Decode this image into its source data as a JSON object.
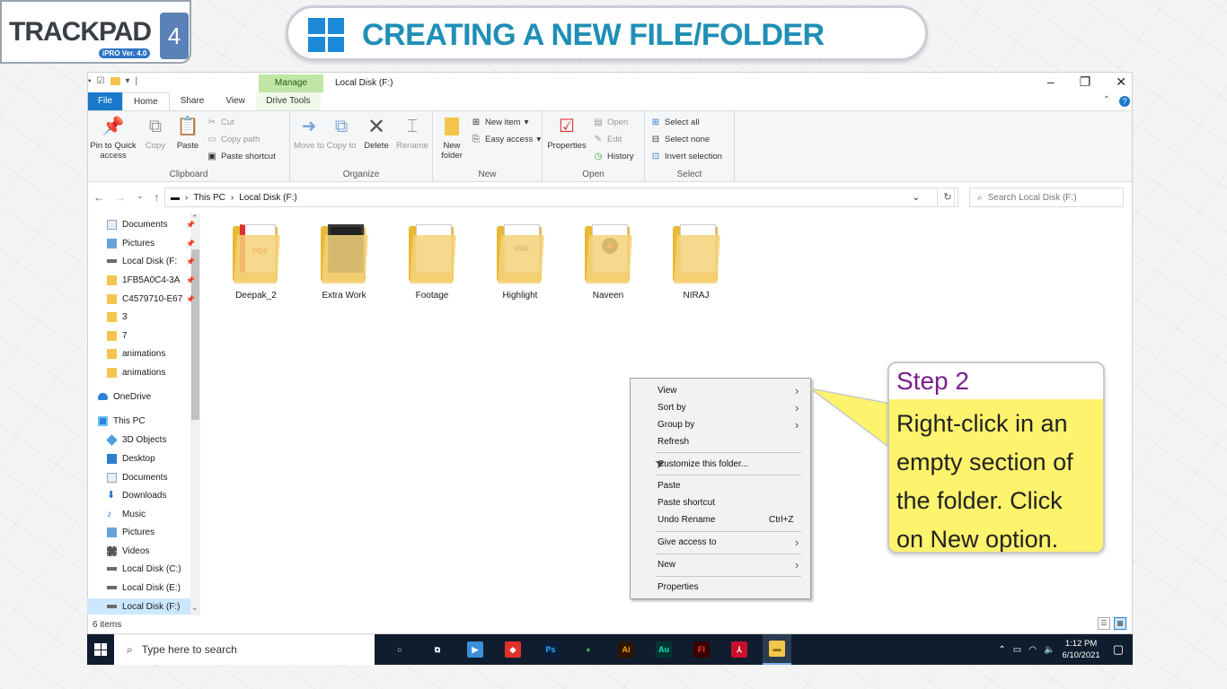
{
  "branding": {
    "logo_text": "TRACKPAD",
    "logo_sub": "iPRO Ver. 4.0",
    "logo_num": "4",
    "title": "CREATING A NEW FILE/FOLDER"
  },
  "window": {
    "manage_tab": "Manage",
    "title": "Local Disk (F:)",
    "tabs": [
      "File",
      "Home",
      "Share",
      "View",
      "Drive Tools"
    ]
  },
  "ribbon": {
    "clipboard": {
      "label": "Clipboard",
      "pin": "Pin to Quick access",
      "copy": "Copy",
      "paste": "Paste",
      "cut": "Cut",
      "copy_path": "Copy path",
      "paste_shortcut": "Paste shortcut"
    },
    "organize": {
      "label": "Organize",
      "move_to": "Move to",
      "copy_to": "Copy to",
      "delete": "Delete",
      "rename": "Rename"
    },
    "new": {
      "label": "New",
      "new_folder": "New folder",
      "new_item": "New item",
      "easy_access": "Easy access"
    },
    "open": {
      "label": "Open",
      "properties": "Properties",
      "open": "Open",
      "edit": "Edit",
      "history": "History"
    },
    "select": {
      "label": "Select",
      "select_all": "Select all",
      "select_none": "Select none",
      "invert": "Invert selection"
    }
  },
  "address": {
    "path": [
      "This PC",
      "Local Disk (F:)"
    ],
    "search_placeholder": "Search Local Disk (F:)"
  },
  "nav": {
    "items": [
      {
        "label": "Documents",
        "icon": "doc",
        "pinned": true
      },
      {
        "label": "Pictures",
        "icon": "pic",
        "pinned": true
      },
      {
        "label": "Local Disk (F:",
        "icon": "drive",
        "pinned": true
      },
      {
        "label": "1FB5A0C4-3A",
        "icon": "fold",
        "pinned": true
      },
      {
        "label": "C4579710-E67",
        "icon": "fold",
        "pinned": true
      },
      {
        "label": "3",
        "icon": "fold",
        "pinned": false
      },
      {
        "label": "7",
        "icon": "fold",
        "pinned": false
      },
      {
        "label": "animations",
        "icon": "fold",
        "pinned": false
      },
      {
        "label": "animations",
        "icon": "fold",
        "pinned": false
      },
      {
        "label": "OneDrive",
        "icon": "cloud",
        "pinned": false
      },
      {
        "label": "This PC",
        "icon": "pc",
        "pinned": false
      },
      {
        "label": "3D Objects",
        "icon": "cube",
        "pinned": false
      },
      {
        "label": "Desktop",
        "icon": "desk",
        "pinned": false
      },
      {
        "label": "Documents",
        "icon": "doc",
        "pinned": false
      },
      {
        "label": "Downloads",
        "icon": "down",
        "pinned": false
      },
      {
        "label": "Music",
        "icon": "music",
        "pinned": false
      },
      {
        "label": "Pictures",
        "icon": "pic",
        "pinned": false
      },
      {
        "label": "Videos",
        "icon": "video",
        "pinned": false
      },
      {
        "label": "Local Disk (C:)",
        "icon": "drive",
        "pinned": false
      },
      {
        "label": "Local Disk (E:)",
        "icon": "drive",
        "pinned": false
      },
      {
        "label": "Local Disk (F:)",
        "icon": "drive",
        "pinned": false
      }
    ]
  },
  "files": [
    {
      "name": "Deepak_2",
      "thumb": "pdf"
    },
    {
      "name": "Extra Work",
      "thumb": "dark"
    },
    {
      "name": "Footage",
      "thumb": "plain"
    },
    {
      "name": "Highlight",
      "thumb": "swf"
    },
    {
      "name": "Naveen",
      "thumb": "vinyl"
    },
    {
      "name": "NIRAJ",
      "thumb": "plain"
    }
  ],
  "status": "6 items",
  "context_menu": {
    "view": "View",
    "sort_by": "Sort by",
    "group_by": "Group by",
    "refresh": "Refresh",
    "customize": "Customize this folder...",
    "paste": "Paste",
    "paste_shortcut": "Paste shortcut",
    "undo_rename": "Undo Rename",
    "undo_shortcut": "Ctrl+Z",
    "give_access": "Give access to",
    "new": "New",
    "properties": "Properties"
  },
  "step": {
    "title": "Step 2",
    "body": "Right-click in an empty section of the folder. Click on New option."
  },
  "taskbar": {
    "search": "Type here to search",
    "apps": [
      {
        "name": "cortana",
        "label": "○",
        "bg": "transparent",
        "fg": "#ffffff"
      },
      {
        "name": "task-view",
        "label": "⧉",
        "bg": "transparent",
        "fg": "#ffffff"
      },
      {
        "name": "media",
        "label": "▶",
        "bg": "#3a8fd8",
        "fg": "#ffffff"
      },
      {
        "name": "anydesk",
        "label": "◆",
        "bg": "#e2312b",
        "fg": "#ffffff"
      },
      {
        "name": "photoshop",
        "label": "Ps",
        "bg": "#0a1f3c",
        "fg": "#31a8ff"
      },
      {
        "name": "chrome",
        "label": "●",
        "bg": "transparent",
        "fg": "#34a853"
      },
      {
        "name": "illustrator",
        "label": "Ai",
        "bg": "#2b1500",
        "fg": "#ff9a00"
      },
      {
        "name": "audition",
        "label": "Au",
        "bg": "#003430",
        "fg": "#00e4bb"
      },
      {
        "name": "flash",
        "label": "Fl",
        "bg": "#3a0000",
        "fg": "#ff3b3b"
      },
      {
        "name": "acrobat",
        "label": "⅄",
        "bg": "#c8102e",
        "fg": "#ffffff"
      },
      {
        "name": "file-explorer",
        "label": "▬",
        "bg": "#f3c64b",
        "fg": "#8a6a10"
      }
    ],
    "time": "1:12 PM",
    "date": "6/10/2021"
  }
}
